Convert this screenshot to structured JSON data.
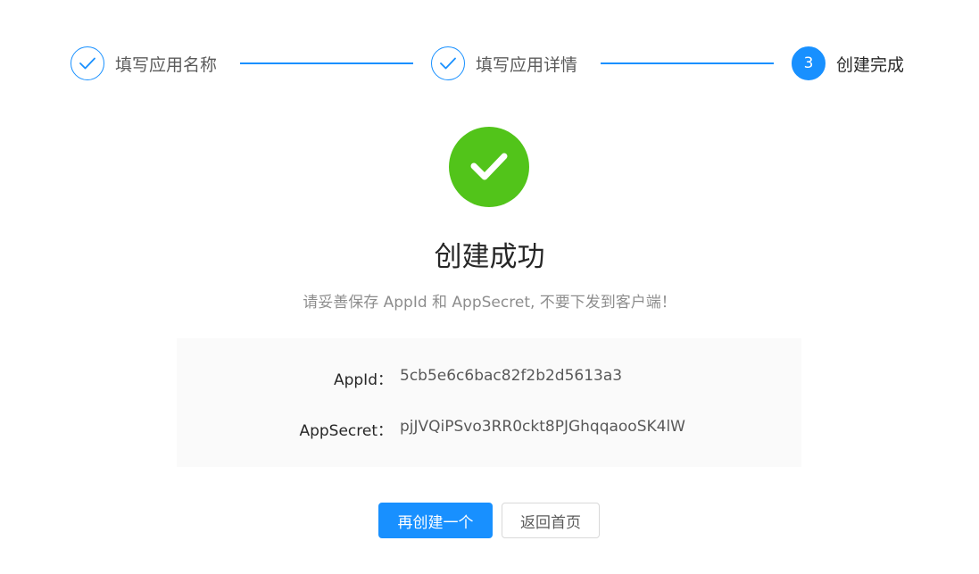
{
  "steps": [
    {
      "title": "填写应用名称",
      "status": "finished"
    },
    {
      "title": "填写应用详情",
      "status": "finished"
    },
    {
      "number": "3",
      "title": "创建完成",
      "status": "active"
    }
  ],
  "result": {
    "title": "创建成功",
    "subtitle": "请妥善保存 AppId 和 AppSecret, 不要下发到客户端！",
    "icon": "check-circle-icon"
  },
  "credentials": {
    "appid_label": "AppId：",
    "appid_value": "5cb5e6c6bac82f2b2d5613a3",
    "secret_label": "AppSecret：",
    "secret_value": "pjJVQiPSvo3RR0ckt8PJGhqqaooSK4lW"
  },
  "actions": {
    "create_again": "再创建一个",
    "back_home": "返回首页"
  },
  "colors": {
    "primary": "#1890ff",
    "success": "#52c41a"
  }
}
